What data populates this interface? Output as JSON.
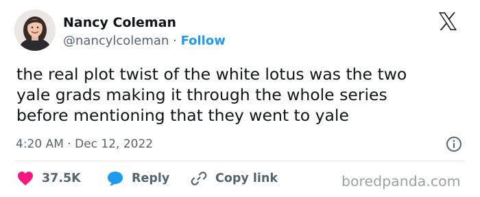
{
  "author": {
    "name": "Nancy Coleman",
    "handle": "@nancylcoleman",
    "separator": "·",
    "follow_label": "Follow",
    "avatar_icon": "profile-photo"
  },
  "platform_icon": "x-logo-icon",
  "tweet": {
    "lines": [
      "the real plot twist of the white lotus was the two",
      "yale grads making it through the whole series",
      "before mentioning that they went to yale"
    ]
  },
  "meta": {
    "time": "4:20 AM",
    "separator": "·",
    "date": "Dec 12, 2022",
    "info_icon": "info-icon"
  },
  "actions": {
    "likes": {
      "count": "37.5K",
      "icon": "heart-icon",
      "color": "#f91880"
    },
    "reply": {
      "label": "Reply",
      "icon": "speech-bubble-icon",
      "color": "#1d9bf0"
    },
    "copy": {
      "label": "Copy link",
      "icon": "link-icon"
    }
  },
  "watermark": "boredpanda.com",
  "colors": {
    "follow": "#1d9bf0",
    "secondary_text": "#536471",
    "heart": "#f91880",
    "reply": "#1d9bf0"
  }
}
